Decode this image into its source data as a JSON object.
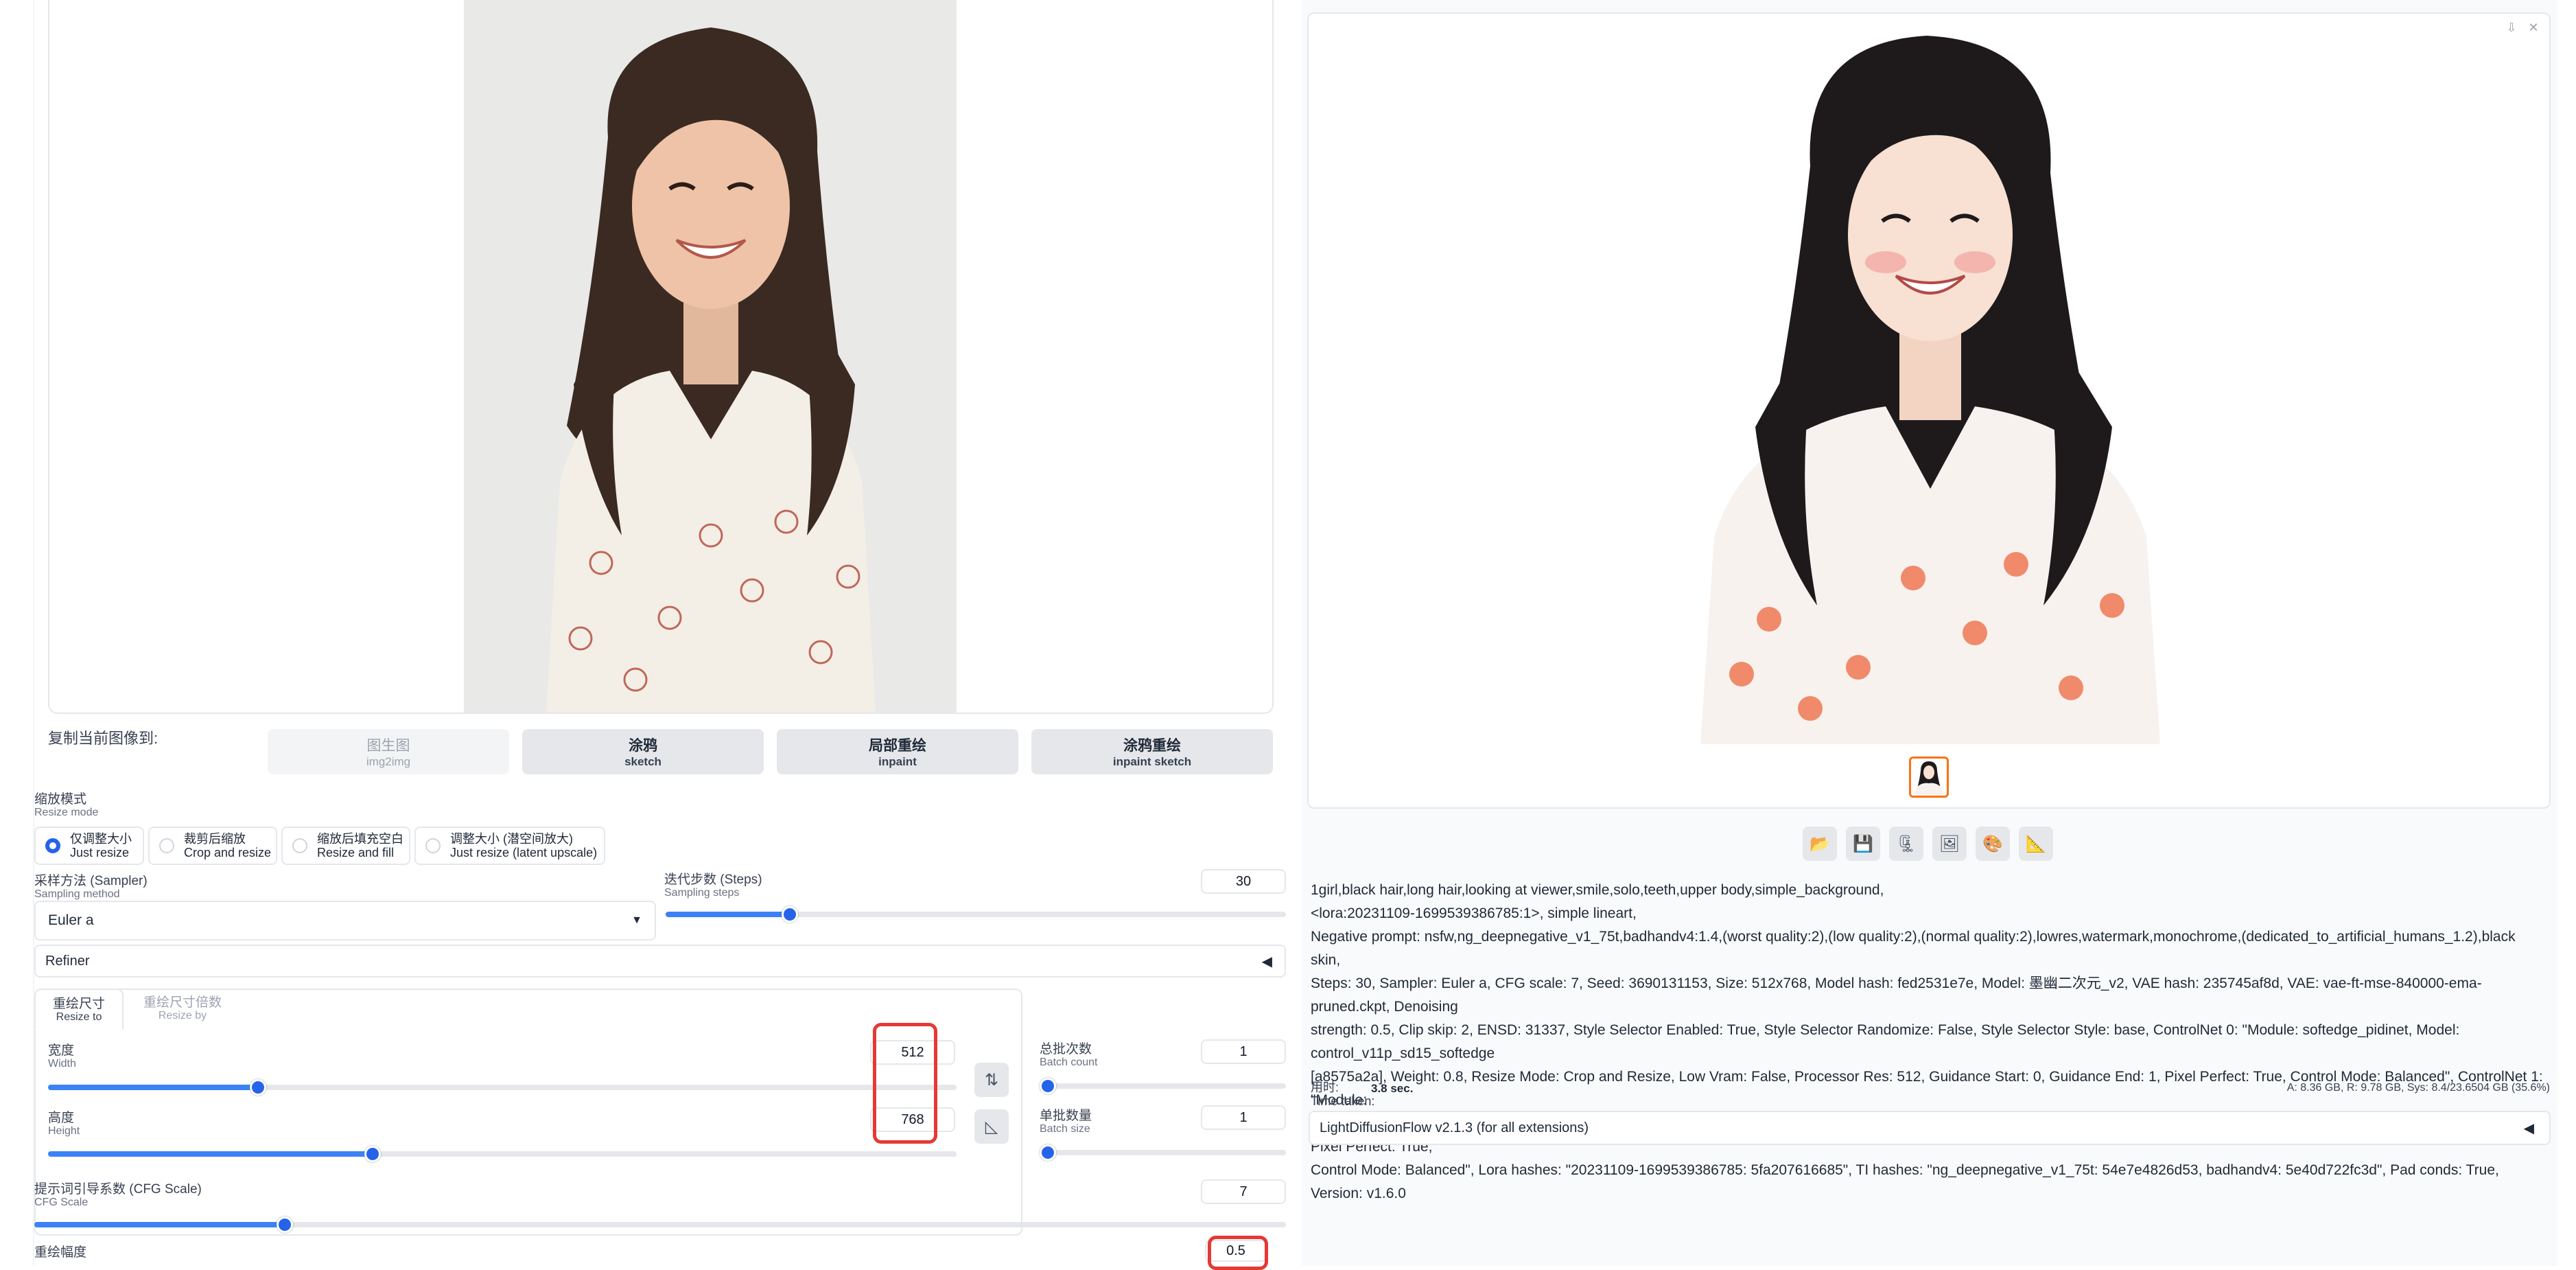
{
  "copy_section": {
    "label": "复制当前图像到:",
    "buttons": [
      {
        "cn": "图生图",
        "en": "img2img",
        "disabled": true
      },
      {
        "cn": "涂鸦",
        "en": "sketch",
        "disabled": false
      },
      {
        "cn": "局部重绘",
        "en": "inpaint",
        "disabled": false
      },
      {
        "cn": "涂鸦重绘",
        "en": "inpaint sketch",
        "disabled": false
      }
    ]
  },
  "resize_mode": {
    "label_cn": "缩放模式",
    "label_en": "Resize mode",
    "options": [
      {
        "cn": "仅调整大小",
        "en": "Just resize",
        "selected": true
      },
      {
        "cn": "裁剪后缩放",
        "en": "Crop and resize",
        "selected": false
      },
      {
        "cn": "缩放后填充空白",
        "en": "Resize and fill",
        "selected": false
      },
      {
        "cn": "调整大小 (潜空间放大)",
        "en": "Just resize (latent upscale)",
        "selected": false
      }
    ]
  },
  "sampler": {
    "label_cn": "采样方法 (Sampler)",
    "label_en": "Sampling method",
    "value": "Euler a"
  },
  "steps": {
    "label_cn": "迭代步数 (Steps)",
    "label_en": "Sampling steps",
    "value": "30",
    "fraction": 0.2
  },
  "refiner": {
    "label": "Refiner"
  },
  "size_tabs": [
    {
      "cn": "重绘尺寸",
      "en": "Resize to",
      "active": true
    },
    {
      "cn": "重绘尺寸倍数",
      "en": "Resize by",
      "active": false
    }
  ],
  "width": {
    "label_cn": "宽度",
    "label_en": "Width",
    "value": "512",
    "fraction": 0.231
  },
  "height": {
    "label_cn": "高度",
    "label_en": "Height",
    "value": "768",
    "fraction": 0.357
  },
  "batch_count": {
    "label_cn": "总批次数",
    "label_en": "Batch count",
    "value": "1",
    "fraction": 0
  },
  "batch_size": {
    "label_cn": "单批数量",
    "label_en": "Batch size",
    "value": "1",
    "fraction": 0
  },
  "cfg": {
    "label_cn": "提示词引导系数 (CFG Scale)",
    "label_en": "CFG Scale",
    "value": "7",
    "fraction": 0.2
  },
  "denoise": {
    "label_cn": "重绘幅度",
    "value": "0.5"
  },
  "output": {
    "info_lines": [
      "1girl,black hair,long hair,looking at viewer,smile,solo,teeth,upper body,simple_background,",
      "<lora:20231109-1699539386785:1>, simple lineart,",
      "Negative prompt: nsfw,ng_deepnegative_v1_75t,badhandv4:1.4,(worst quality:2),(low quality:2),(normal quality:2),lowres,watermark,monochrome,(dedicated_to_artificial_humans_1.2),black skin,",
      "Steps: 30, Sampler: Euler a, CFG scale: 7, Seed: 3690131153, Size: 512x768, Model hash: fed2531e7e, Model: 墨幽二次元_v2, VAE hash: 235745af8d, VAE: vae-ft-mse-840000-ema-pruned.ckpt, Denoising",
      "strength: 0.5, Clip skip: 2, ENSD: 31337, Style Selector Enabled: True, Style Selector Randomize: False, Style Selector Style: base, ControlNet 0: \"Module: softedge_pidinet, Model: control_v11p_sd15_softedge",
      "[a8575a2a], Weight: 0.8, Resize Mode: Crop and Resize, Low Vram: False, Processor Res: 512, Guidance Start: 0, Guidance End: 1, Pixel Perfect: True, Control Mode: Balanced\", ControlNet 1: \"Module:",
      "openpose_faceonly, Model: control_v11p_sd15_openpose [cab727d4], Weight: 1, Resize Mode: Crop and Resize, Low Vram: False, Processor Res: 512, Guidance Start: 0, Guidance End: 1, Pixel Perfect: True,",
      "Control Mode: Balanced\", Lora hashes: \"20231109-1699539386785: 5fa207616685\", TI hashes: \"ng_deepnegative_v1_75t: 54e7e4826d53, badhandv4: 5e40d722fc3d\", Pad conds: True, Version: v1.6.0"
    ],
    "time_label_cn": "用时:",
    "time_label_en": "Time taken:",
    "time_value": "3.8 sec.",
    "mem_a": "A: 8.36 GB, R: 9.78 GB, Sys: 8.4/23.6504 GB (35.6%)",
    "flow_label": "LightDiffusionFlow v2.1.3 (for all extensions)"
  },
  "icons": {
    "folder": "folder-icon",
    "save": "save-icon",
    "zip": "zip-icon",
    "send_img2img": "image-icon",
    "send_inpaint": "palette-icon",
    "send_extras": "ruler-icon"
  },
  "colors": {
    "accent": "#2563eb",
    "highlight": "#e53935",
    "thumb_border": "#f97316"
  }
}
